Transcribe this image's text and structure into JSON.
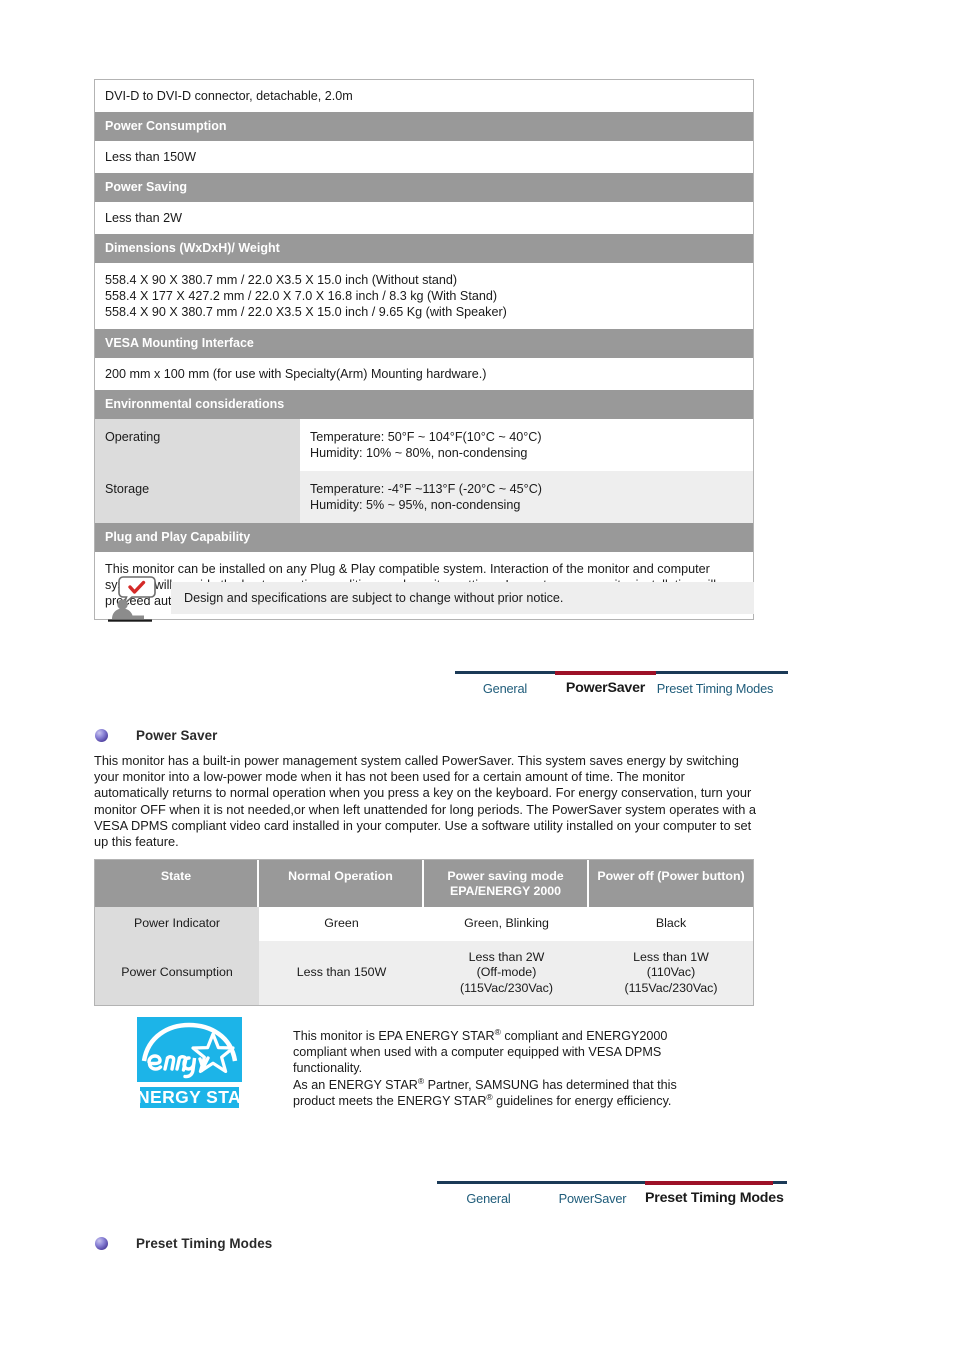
{
  "spec_table": {
    "cable_note": "DVI-D to DVI-D connector, detachable, 2.0m",
    "power_consumption_header": "Power Consumption",
    "power_consumption_value": "Less than 150W",
    "power_saving_header": "Power Saving",
    "power_saving_value": "Less than 2W",
    "dimensions_header": "Dimensions (WxDxH)/ Weight",
    "dimensions_lines": [
      "558.4 X 90 X 380.7 mm / 22.0 X3.5 X 15.0 inch (Without stand)",
      "558.4 X 177 X 427.2 mm / 22.0 X 7.0 X 16.8 inch / 8.3 kg (With Stand)",
      "558.4 X 90 X 380.7 mm / 22.0 X3.5 X 15.0 inch / 9.65 Kg (with Speaker)"
    ],
    "vesa_header": "VESA Mounting Interface",
    "vesa_value": "200 mm x 100 mm (for use with Specialty(Arm) Mounting hardware.)",
    "environmental_header": "Environmental considerations",
    "operating_label": "Operating",
    "operating_lines": [
      "Temperature: 50°F ~ 104°F(10°C ~ 40°C)",
      "Humidity: 10% ~ 80%, non-condensing"
    ],
    "storage_label": "Storage",
    "storage_lines": [
      "Temperature: -4°F ~113°F (-20°C ~ 45°C)",
      "Humidity: 5% ~ 95%, non-condensing"
    ],
    "plug_play_header": "Plug and Play Capability",
    "plug_play_text": "This monitor can be installed on any Plug & Play compatible system. Interaction of the monitor and computer systems will provide the best operating conditions and monitor settings. In most cases, monitor installation will proceed automatically, unless the user wishes to select alternate settings."
  },
  "note": {
    "icon": "person-speech-check-icon",
    "text": "Design and specifications are subject to change without prior notice."
  },
  "tabs_top": {
    "items": [
      {
        "label": "General",
        "active": false
      },
      {
        "label": "PowerSaver",
        "active": true
      },
      {
        "label": "Preset Timing Modes",
        "active": false
      }
    ]
  },
  "tabs_bottom": {
    "items": [
      {
        "label": "General",
        "active": false
      },
      {
        "label": "PowerSaver",
        "active": false
      },
      {
        "label": "Preset Timing Modes",
        "active": true
      }
    ]
  },
  "power_saver_section": {
    "heading": "Power Saver",
    "paragraph": "This monitor has a built-in power management system called PowerSaver. This system saves energy by switching your monitor into a low-power mode when it has not been used for a certain amount of time. The monitor automatically returns to normal operation when you press a key on the keyboard. For energy conservation, turn your monitor OFF when it is not needed,or when left unattended for long periods. The PowerSaver system operates with a VESA DPMS compliant video card installed in your computer. Use a software utility installed on your computer to set up this feature."
  },
  "power_saver_table": {
    "headers": [
      "State",
      "Normal Operation",
      [
        "Power saving mode",
        "EPA/ENERGY 2000"
      ],
      [
        "Power off",
        "(Power button)"
      ]
    ],
    "rows": [
      {
        "label": "Power Indicator",
        "cells": [
          [
            "Green"
          ],
          [
            "Green, Blinking"
          ],
          [
            "Black"
          ]
        ]
      },
      {
        "label": "Power Consumption",
        "cells": [
          [
            "Less than 150W"
          ],
          [
            "Less than 2W",
            "(Off-mode)",
            "(115Vac/230Vac)"
          ],
          [
            "Less than 1W",
            "(110Vac)",
            "(115Vac/230Vac)"
          ]
        ]
      }
    ]
  },
  "energy_star": {
    "logo_script_text": "energy",
    "logo_label": "ENERGY STAR",
    "logo_color": "#1cb4e8",
    "lines": [
      "This monitor is EPA ENERGY STAR® compliant and ENERGY2000",
      "compliant when used with a computer equipped with VESA DPMS",
      "functionality.",
      "As an ENERGY STAR® Partner, SAMSUNG has determined that this",
      "product meets the ENERGY STAR® guidelines for energy efficiency."
    ]
  },
  "preset_timing_section": {
    "heading": "Preset Timing Modes"
  },
  "colors": {
    "band_gray": "#999999",
    "cell_gray": "#dcdcdc",
    "shade_gray": "#eeeeee",
    "tab_link": "#1f5c7a",
    "tab_active_bar": "#9d1127",
    "tab_inactive_bar": "#1b3a57",
    "bullet": "#4e3f9e"
  }
}
